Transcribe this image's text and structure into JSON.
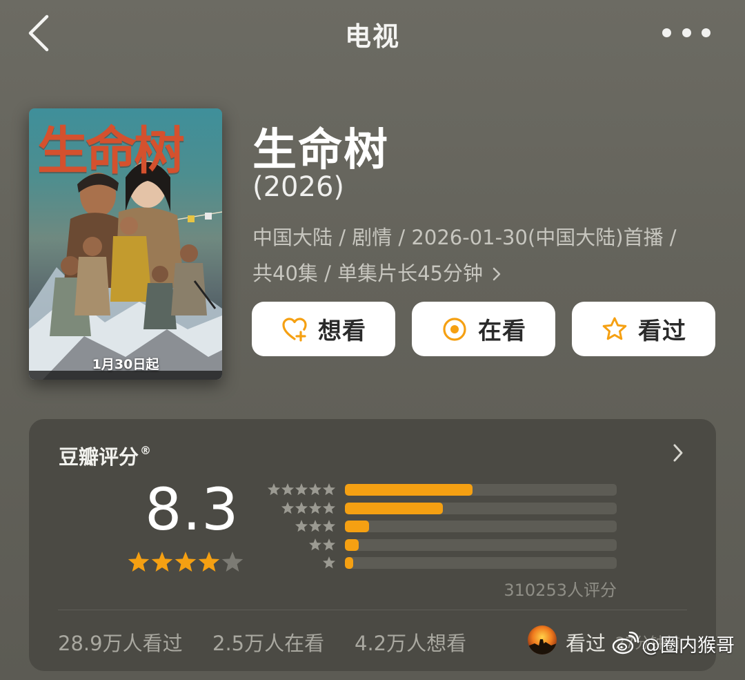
{
  "header": {
    "title": "电视",
    "back_icon": "chevron-left-icon",
    "more_icon": "more-horizontal-icon"
  },
  "poster": {
    "title_text": "生命树",
    "date_text": "1月30日起"
  },
  "show": {
    "title": "生命树",
    "year": "(2026)",
    "meta_line1": "中国大陆 / 剧情 / 2026-01-30(中国大陆)首播 /",
    "meta_line2": "共40集 / 单集片长45分钟"
  },
  "actions": {
    "want_label": "想看",
    "want_icon": "heart-plus-icon",
    "watching_label": "在看",
    "watching_icon": "target-icon",
    "watched_label": "看过",
    "watched_icon": "star-outline-icon",
    "accent_color": "#f5a012"
  },
  "rating": {
    "title": "豆瓣评分",
    "registered_mark": "®",
    "score": "8.3",
    "stars_filled": 4,
    "stars_total": 5,
    "distribution": [
      {
        "stars": 5,
        "fraction": 0.47
      },
      {
        "stars": 4,
        "fraction": 0.36
      },
      {
        "stars": 3,
        "fraction": 0.09
      },
      {
        "stars": 2,
        "fraction": 0.05
      },
      {
        "stars": 1,
        "fraction": 0.03
      }
    ],
    "count_text": "310253人评分"
  },
  "stats": {
    "watched": "28.9万人看过",
    "watching": "2.5万人在看",
    "want": "4.2万人想看"
  },
  "friend": {
    "status": "看过",
    "time": "27分钟前"
  },
  "watermark": {
    "text": "@圈内猴哥"
  },
  "colors": {
    "background": "#64635b",
    "card": "#4b4a44",
    "star": "#f5a012"
  }
}
